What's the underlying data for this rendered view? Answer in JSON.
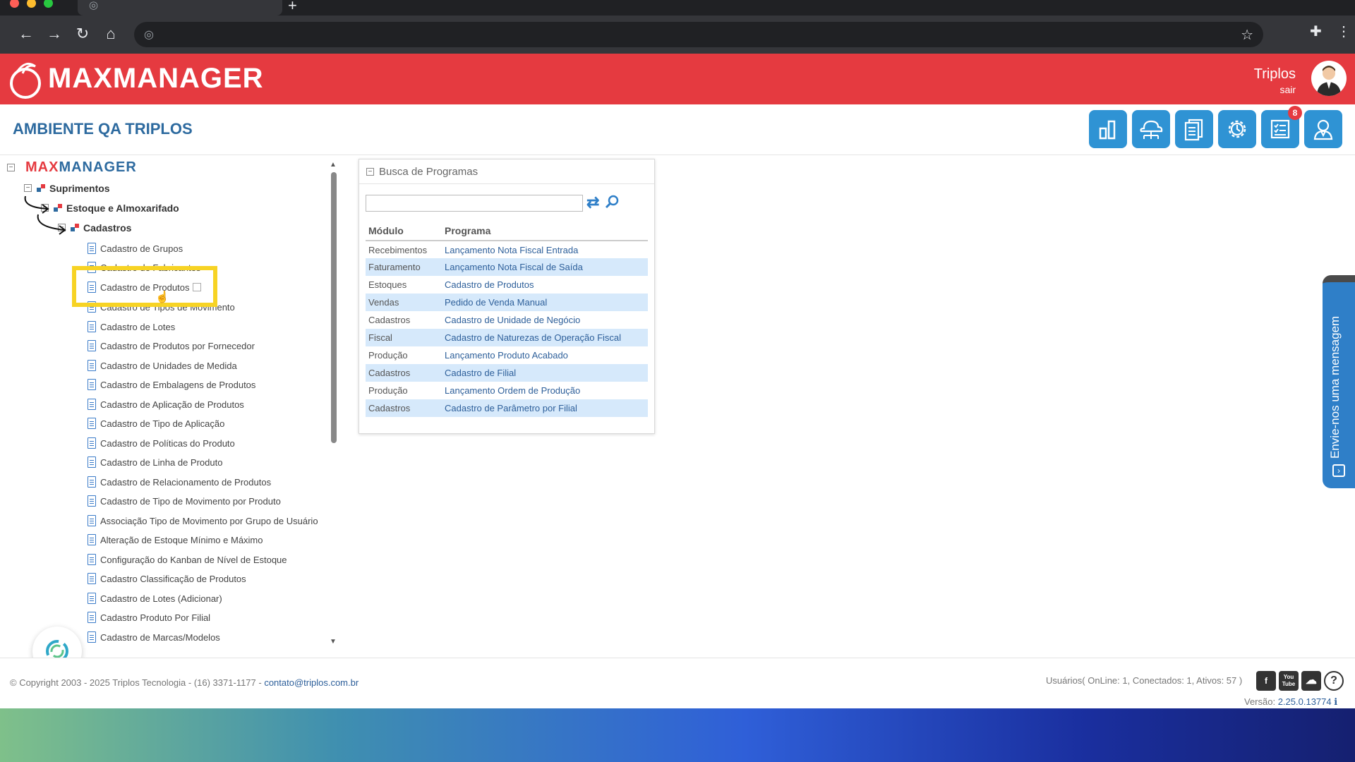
{
  "browser": {
    "new_tab_label": "+"
  },
  "header": {
    "logo_text": "MAXMANAGER",
    "user_name": "Triplos",
    "user_exit": "sair"
  },
  "subheader": {
    "env_title": "AMBIENTE QA TRIPLOS",
    "quick_buttons": [
      {
        "icon": "reports-chart-icon"
      },
      {
        "icon": "network-api-icon"
      },
      {
        "icon": "documents-icon"
      },
      {
        "icon": "settings-gear-icon"
      },
      {
        "icon": "tasks-checklist-icon",
        "badge": "8"
      },
      {
        "icon": "support-user-icon"
      }
    ]
  },
  "tree": {
    "root": {
      "max": "MAX",
      "mgr": "MANAGER"
    },
    "level1": "Suprimentos",
    "level2": "Estoque e Almoxarifado",
    "level3": "Cadastros",
    "items": [
      "Cadastro de Grupos",
      "Cadastro de Fabricantes",
      "Cadastro de Produtos",
      "Cadastro de Tipos de Movimento",
      "Cadastro de Lotes",
      "Cadastro de Produtos por Fornecedor",
      "Cadastro de Unidades de Medida",
      "Cadastro de Embalagens de Produtos",
      "Cadastro de Aplicação de Produtos",
      "Cadastro de Tipo de Aplicação",
      "Cadastro de Políticas do Produto",
      "Cadastro de Linha de Produto",
      "Cadastro de Relacionamento de Produtos",
      "Cadastro de Tipo de Movimento por Produto",
      "Associação Tipo de Movimento por Grupo de Usuário",
      "Alteração de Estoque Mínimo e Máximo",
      "Configuração do Kanban de Nível de Estoque",
      "Cadastro Classificação de Produtos",
      "Cadastro de Lotes (Adicionar)",
      "Cadastro Produto Por Filial",
      "Cadastro de Marcas/Modelos"
    ]
  },
  "search": {
    "title": "Busca de Programas",
    "input_value": "",
    "columns": {
      "module": "Módulo",
      "program": "Programa"
    },
    "rows": [
      {
        "module": "Recebimentos",
        "program": "Lançamento Nota Fiscal Entrada"
      },
      {
        "module": "Faturamento",
        "program": "Lançamento Nota Fiscal de Saída"
      },
      {
        "module": "Estoques",
        "program": "Cadastro de Produtos"
      },
      {
        "module": "Vendas",
        "program": "Pedido de Venda Manual"
      },
      {
        "module": "Cadastros",
        "program": "Cadastro de Unidade de Negócio"
      },
      {
        "module": "Fiscal",
        "program": "Cadastro de Naturezas de Operação Fiscal"
      },
      {
        "module": "Produção",
        "program": "Lançamento Produto Acabado"
      },
      {
        "module": "Cadastros",
        "program": "Cadastro de Filial"
      },
      {
        "module": "Produção",
        "program": "Lançamento Ordem de Produção"
      },
      {
        "module": "Cadastros",
        "program": "Cadastro de Parâmetro por Filial"
      }
    ]
  },
  "feedback": {
    "label": "Envie-nos uma mensagem"
  },
  "footer": {
    "copyright": "© Copyright 2003 - 2025 Triplos Tecnologia - (16) 3371-1177 - ",
    "contact_email": "contato@triplos.com.br",
    "users": "Usuários( OnLine: 1, Conectados: 1, Ativos: 57 )",
    "version_label": "Versão: ",
    "version_number": "2.25.0.13774",
    "social": [
      {
        "icon": "facebook-icon",
        "glyph": "f"
      },
      {
        "icon": "youtube-icon",
        "glyph": "You Tube"
      },
      {
        "icon": "cloud-icon",
        "glyph": "☁"
      },
      {
        "icon": "help-icon",
        "glyph": "?"
      }
    ]
  },
  "colors": {
    "header_red": "#e53a40",
    "brand_blue": "#2d6a9f",
    "button_blue": "#2f93d4",
    "highlight_yellow": "#f7d324",
    "row_alt": "#d6e9fb"
  }
}
